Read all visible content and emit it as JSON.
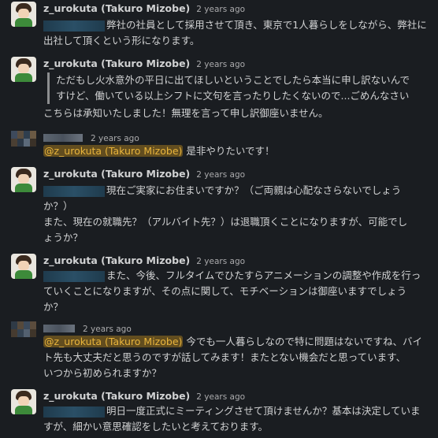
{
  "messages": [
    {
      "name": "z_urokuta (Takuro Mizobe)",
      "time": "2 years ago",
      "lines": [
        "弊社の社員として採用させて頂き、東京で1人暮らしをしながら、弊社に",
        "出社して頂くという形になります。"
      ]
    },
    {
      "name": "z_urokuta (Takuro Mizobe)",
      "time": "2 years ago",
      "quote": [
        "ただもし火水意外の平日に出てほしいということでしたら本当に申し訳ないんで",
        "すけど、働いている以上シフトに文句を言ったりしたくないので...ごめんなさい"
      ],
      "lines": [
        "こちらは承知いたしました！無理を言って申し訳御座いません。"
      ]
    },
    {
      "time": "2 years ago",
      "mention": "@z_urokuta (Takuro Mizobe)",
      "after_mention": "是非やりたいです！"
    },
    {
      "name": "z_urokuta (Takuro Mizobe)",
      "time": "2 years ago",
      "lines": [
        "現在ご実家にお住まいですか？（ご両親は心配なさらないでしょう",
        "か？）",
        "また、現在の就職先？（アルバイト先？）は退職頂くことになりますが、可能でし",
        "ょうか？"
      ]
    },
    {
      "name": "z_urokuta (Takuro Mizobe)",
      "time": "2 years ago",
      "lines": [
        "また、今後、フルタイムでひたすらアニメーションの調整や作成を行っ",
        "ていくことになりますが、その点に関して、モチベーションは御座いますでしょう",
        "か？"
      ]
    },
    {
      "time": "2 years ago",
      "mention": "@z_urokuta (Takuro Mizobe)",
      "after_mention": "今でも一人暮らしなので特に問題はないですね、バイ",
      "lines": [
        "ト先も大丈夫だと思うのですが話してみます！またとない機会だと思っています、",
        "いつから初められますか？"
      ]
    },
    {
      "name": "z_urokuta (Takuro Mizobe)",
      "time": "2 years ago",
      "lines": [
        "明日一度正式にミーティングさせて頂けませんか？基本は決定していま",
        "すが、細かい意思確認をしたいと考えております。"
      ]
    }
  ]
}
